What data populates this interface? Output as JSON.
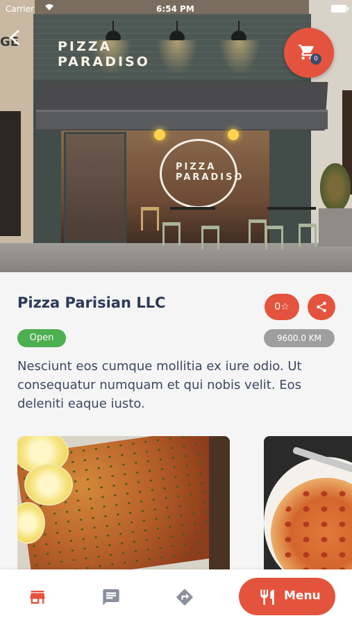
{
  "status_bar": {
    "carrier": "Carrier",
    "time": "6:54 PM"
  },
  "hero": {
    "sign_line1": "PIZZA",
    "sign_line2": "PARADISO",
    "window_logo": "PIZZA PARADISO",
    "left_edge_text": "GE",
    "cart_count": "0"
  },
  "restaurant": {
    "name": "Pizza Parisian LLC",
    "rating_button": "0☆",
    "status": "Open",
    "distance": "9600.0 KM",
    "description": "Nesciunt eos cumque mollitia ex iure odio. Ut consequatur numquam et qui nobis velit. Eos deleniti eaque iusto."
  },
  "gallery": [
    {
      "name": "salmon-photo"
    },
    {
      "name": "pizza-photo"
    }
  ],
  "bottom_nav": {
    "menu_label": "Menu",
    "icons": [
      "store-icon",
      "chat-icon",
      "directions-icon",
      "fork-knife-icon"
    ]
  },
  "colors": {
    "accent": "#e4533d",
    "title": "#2c3a57",
    "open": "#4caf50",
    "distance_badge": "#9e9e9e",
    "body_text": "#3d4663"
  }
}
